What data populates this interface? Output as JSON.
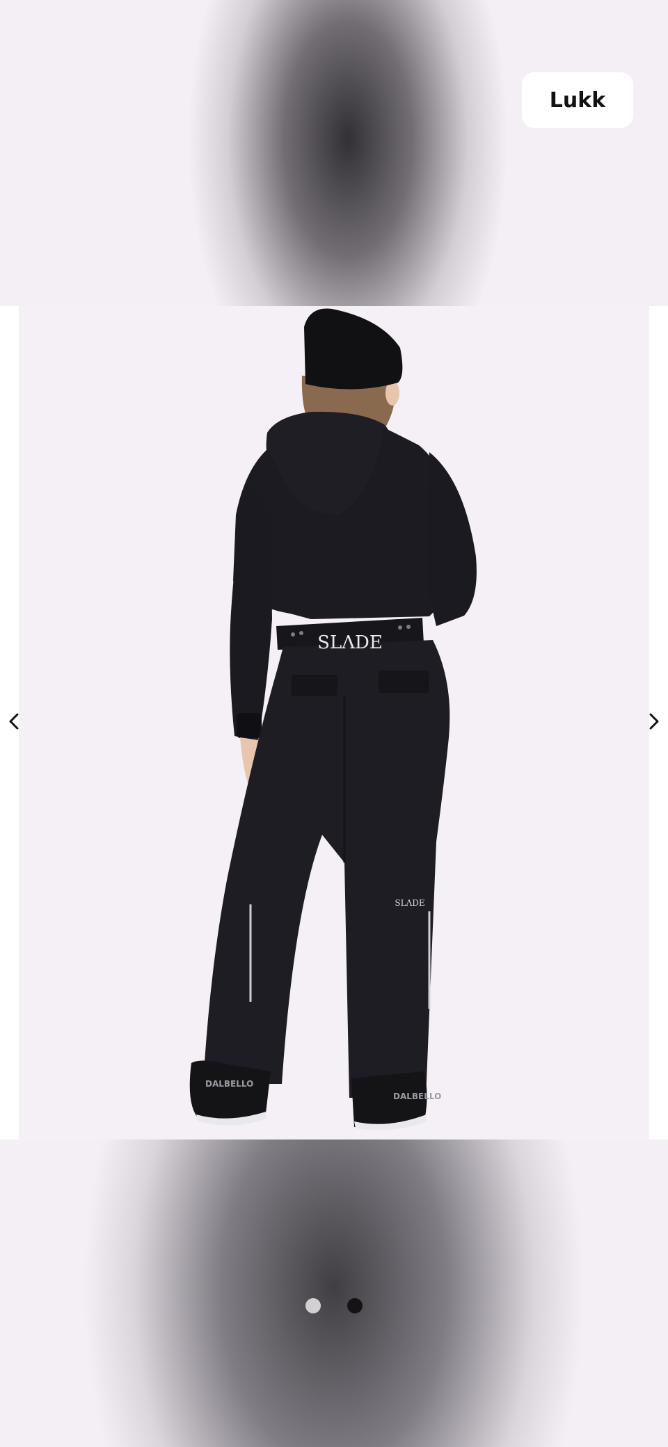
{
  "viewer": {
    "close_label": "Lukk"
  },
  "image": {
    "brand_logo": "SLΛDE",
    "brand_logo_small": "SLΛDE",
    "boot_text": "DALBELLO"
  },
  "navigation": {
    "prev_icon": "chevron-left-icon",
    "next_icon": "chevron-right-icon"
  },
  "pagination": {
    "total": 2,
    "active_index": 1
  },
  "colors": {
    "background": "#f4eff5",
    "garment": "#1c1c22",
    "active_dot": "#151315",
    "inactive_dot": "#d3d0d3"
  }
}
